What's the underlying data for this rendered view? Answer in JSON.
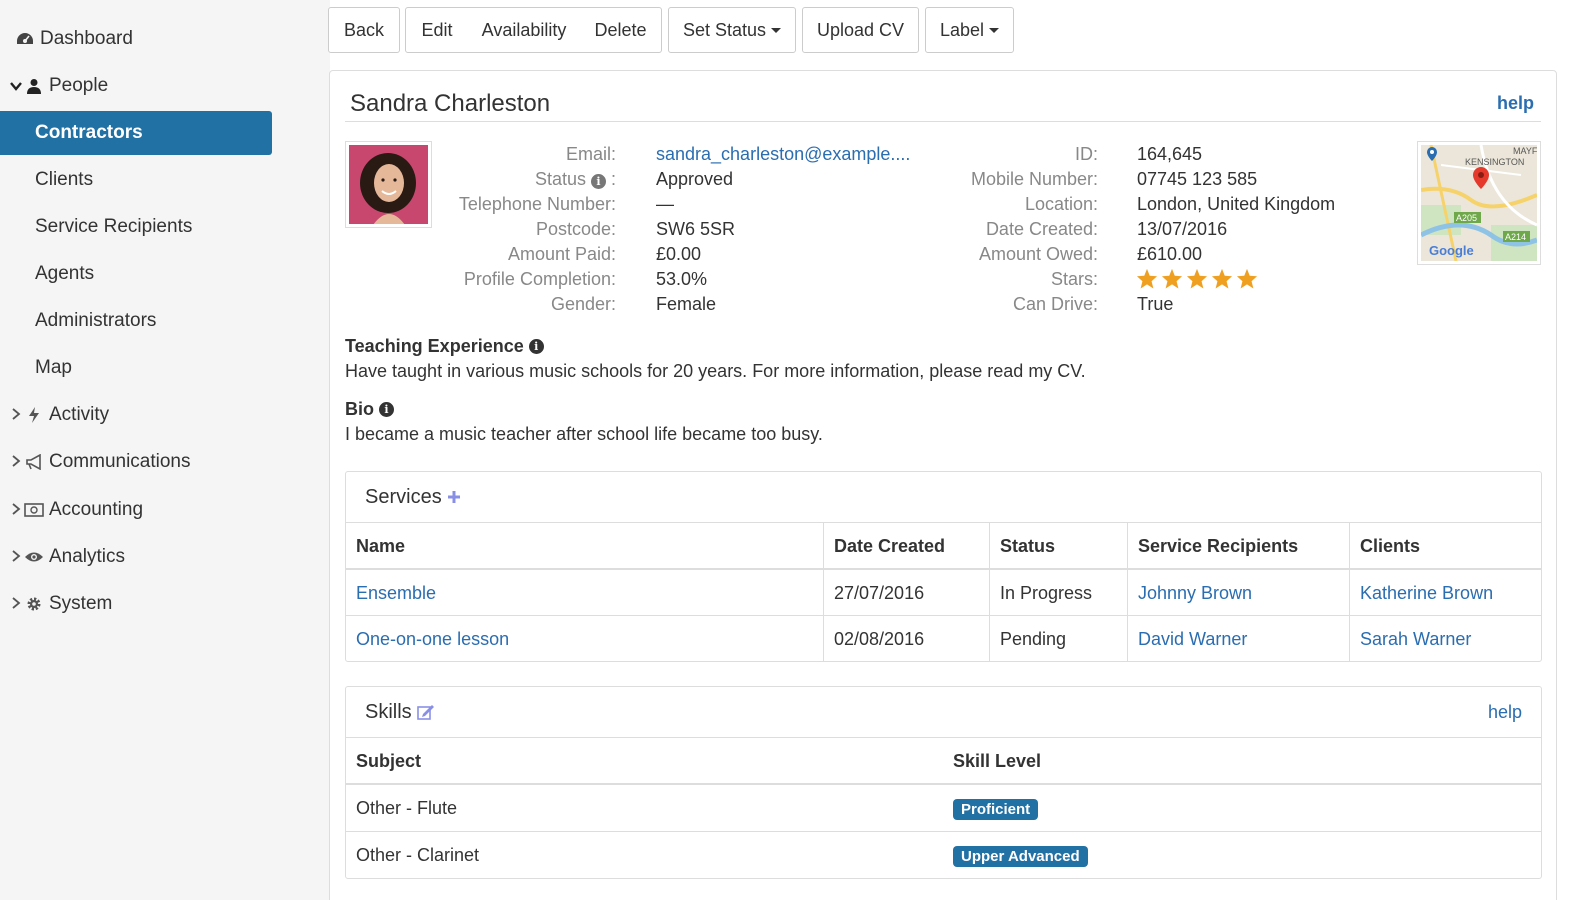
{
  "sidebar": {
    "items": [
      {
        "label": "Dashboard",
        "icon": "dashboard-icon"
      },
      {
        "label": "People",
        "icon": "user-icon",
        "expanded": true
      },
      {
        "label": "Contractors",
        "active": true
      },
      {
        "label": "Clients"
      },
      {
        "label": "Service Recipients"
      },
      {
        "label": "Agents"
      },
      {
        "label": "Administrators"
      },
      {
        "label": "Map"
      },
      {
        "label": "Activity",
        "icon": "bolt-icon"
      },
      {
        "label": "Communications",
        "icon": "bullhorn-icon"
      },
      {
        "label": "Accounting",
        "icon": "money-icon"
      },
      {
        "label": "Analytics",
        "icon": "eye-icon"
      },
      {
        "label": "System",
        "icon": "gear-icon"
      }
    ]
  },
  "toolbar": {
    "back": "Back",
    "edit": "Edit",
    "availability": "Availability",
    "delete": "Delete",
    "set_status": "Set Status",
    "upload_cv": "Upload CV",
    "label": "Label"
  },
  "profile": {
    "name": "Sandra Charleston",
    "help": "help",
    "left_fields": [
      {
        "label": "Email:",
        "value": "sandra_charleston@example...."
      },
      {
        "label": "Status",
        "value": "Approved"
      },
      {
        "label": "Telephone Number:",
        "value": "—"
      },
      {
        "label": "Postcode:",
        "value": "SW6 5SR"
      },
      {
        "label": "Amount Paid:",
        "value": "£0.00"
      },
      {
        "label": "Profile Completion:",
        "value": "53.0%"
      },
      {
        "label": "Gender:",
        "value": "Female"
      }
    ],
    "right_fields": [
      {
        "label": "ID:",
        "value": "164,645"
      },
      {
        "label": "Mobile Number:",
        "value": "07745 123 585"
      },
      {
        "label": "Location:",
        "value": "London, United Kingdom"
      },
      {
        "label": "Date Created:",
        "value": "13/07/2016"
      },
      {
        "label": "Amount Owed:",
        "value": "£610.00"
      },
      {
        "label": "Stars:",
        "value": 5
      },
      {
        "label": "Can Drive:",
        "value": "True"
      }
    ],
    "status_colon": ":",
    "map": {
      "area": "KENSINGTON",
      "corner": "MAYF",
      "road1": "A205",
      "road2": "A214",
      "brand": "Google"
    }
  },
  "teaching": {
    "title": "Teaching Experience",
    "text": "Have taught in various music schools for 20 years. For more information, please read my CV."
  },
  "bio": {
    "title": "Bio",
    "text": "I became a music teacher after school life became too busy."
  },
  "services": {
    "title": "Services",
    "add_icon": "plus-icon",
    "columns": [
      "Name",
      "Date Created",
      "Status",
      "Service Recipients",
      "Clients"
    ],
    "rows": [
      [
        "Ensemble",
        "27/07/2016",
        "In Progress",
        "Johnny Brown",
        "Katherine Brown"
      ],
      [
        "One-on-one lesson",
        "02/08/2016",
        "Pending",
        "David Warner",
        "Sarah Warner"
      ]
    ]
  },
  "skills": {
    "title": "Skills",
    "help": "help",
    "columns": [
      "Subject",
      "Skill Level"
    ],
    "rows": [
      [
        "Other - Flute",
        "Proficient"
      ],
      [
        "Other - Clarinet",
        "Upper Advanced"
      ]
    ]
  },
  "colors": {
    "accent": "#2271a5",
    "link": "#2a6db0",
    "star": "#f0a020"
  }
}
